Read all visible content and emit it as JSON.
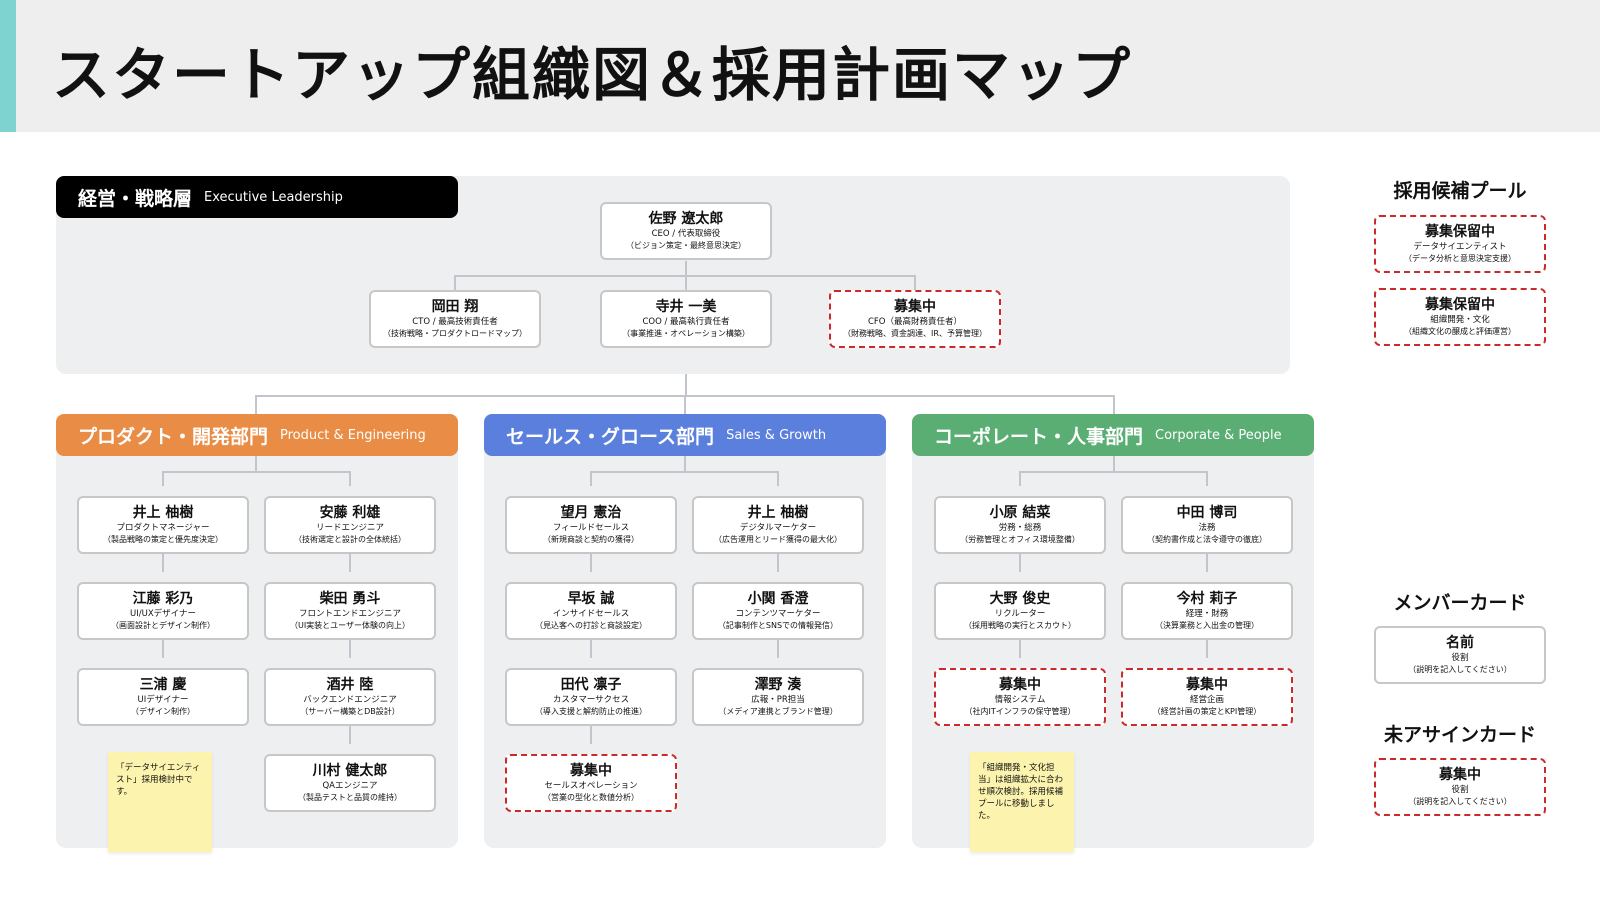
{
  "title": "スタートアップ組織図＆採用計画マップ",
  "colors": {
    "accent": "#7ed3d1",
    "product": "#e98c45",
    "sales": "#5b7fdc",
    "corporate": "#5bae73",
    "vacancy_border": "#cc2a2a",
    "sticky": "#fcf4ae"
  },
  "executive": {
    "label_ja": "経営・戦略層",
    "label_en": "Executive Leadership",
    "ceo": {
      "name": "佐野 遼太郎",
      "role": "CEO / 代表取締役",
      "desc": "（ビジョン策定・最終意思決定）"
    },
    "cto": {
      "name": "岡田 翔",
      "role": "CTO / 最高技術責任者",
      "desc": "（技術戦略・プロダクトロードマップ）"
    },
    "coo": {
      "name": "寺井 一美",
      "role": "COO / 最高執行責任者",
      "desc": "（事業推進・オペレーション構築）"
    },
    "cfo": {
      "name": "募集中",
      "role": "CFO（最高財務責任者）",
      "desc": "（財務戦略、資金調達、IR、予算管理）"
    }
  },
  "product": {
    "label_ja": "プロダクト・開発部門",
    "label_en": "Product & Engineering",
    "col1": [
      {
        "name": "井上 柚樹",
        "role": "プロダクトマネージャー",
        "desc": "（製品戦略の策定と優先度決定）"
      },
      {
        "name": "江藤 彩乃",
        "role": "UI/UXデザイナー",
        "desc": "（画面設計とデザイン制作）"
      },
      {
        "name": "三浦 慶",
        "role": "UIデザイナー",
        "desc": "（デザイン制作）"
      }
    ],
    "col2": [
      {
        "name": "安藤 利雄",
        "role": "リードエンジニア",
        "desc": "（技術選定と設計の全体統括）"
      },
      {
        "name": "柴田 勇斗",
        "role": "フロントエンドエンジニア",
        "desc": "（UI実装とユーザー体験の向上）"
      },
      {
        "name": "酒井 陸",
        "role": "バックエンドエンジニア",
        "desc": "（サーバー構築とDB設計）"
      },
      {
        "name": "川村 健太郎",
        "role": "QAエンジニア",
        "desc": "（製品テストと品質の維持）"
      }
    ],
    "note": "「データサイエンティスト」採用検討中です。"
  },
  "sales": {
    "label_ja": "セールス・グロース部門",
    "label_en": "Sales & Growth",
    "col1": [
      {
        "name": "望月 憲治",
        "role": "フィールドセールス",
        "desc": "（新規商談と契約の獲得）"
      },
      {
        "name": "早坂 誠",
        "role": "インサイドセールス",
        "desc": "（見込客への打診と商談設定）"
      },
      {
        "name": "田代 凛子",
        "role": "カスタマーサクセス",
        "desc": "（導入支援と解約防止の推進）"
      },
      {
        "name": "募集中",
        "role": "セールスオペレーション",
        "desc": "（営業の型化と数値分析）"
      }
    ],
    "col2": [
      {
        "name": "井上 柚樹",
        "role": "デジタルマーケター",
        "desc": "（広告運用とリード獲得の最大化）"
      },
      {
        "name": "小関 香澄",
        "role": "コンテンツマーケター",
        "desc": "（記事制作とSNSでの情報発信）"
      },
      {
        "name": "澤野 湊",
        "role": "広報・PR担当",
        "desc": "（メディア連携とブランド管理）"
      }
    ]
  },
  "corporate": {
    "label_ja": "コーポレート・人事部門",
    "label_en": "Corporate & People",
    "col1": [
      {
        "name": "小原 結菜",
        "role": "労務・総務",
        "desc": "（労務管理とオフィス環境整備）"
      },
      {
        "name": "大野 俊史",
        "role": "リクルーター",
        "desc": "（採用戦略の実行とスカウト）"
      },
      {
        "name": "募集中",
        "role": "情報システム",
        "desc": "（社内ITインフラの保守管理）"
      }
    ],
    "col2": [
      {
        "name": "中田 博司",
        "role": "法務",
        "desc": "（契約書作成と法令遵守の徹底）"
      },
      {
        "name": "今村 莉子",
        "role": "経理・財務",
        "desc": "（決算業務と入出金の管理）"
      },
      {
        "name": "募集中",
        "role": "経営企画",
        "desc": "（経営計画の策定とKPI管理）"
      }
    ],
    "note": "「組織開発・文化担当」は組織拡大に合わせ順次検討。採用候補プールに移動しました。"
  },
  "sidebar": {
    "pool_title": "採用候補プール",
    "pool": [
      {
        "name": "募集保留中",
        "role": "データサイエンティスト",
        "desc": "（データ分析と意思決定支援）"
      },
      {
        "name": "募集保留中",
        "role": "組織開発・文化",
        "desc": "（組織文化の醸成と評価運営）"
      }
    ],
    "member_title": "メンバーカード",
    "member_card": {
      "name": "名前",
      "role": "役割",
      "desc": "（説明を記入してください）"
    },
    "unassigned_title": "未アサインカード",
    "unassigned_card": {
      "name": "募集中",
      "role": "役割",
      "desc": "（説明を記入してください）"
    }
  }
}
